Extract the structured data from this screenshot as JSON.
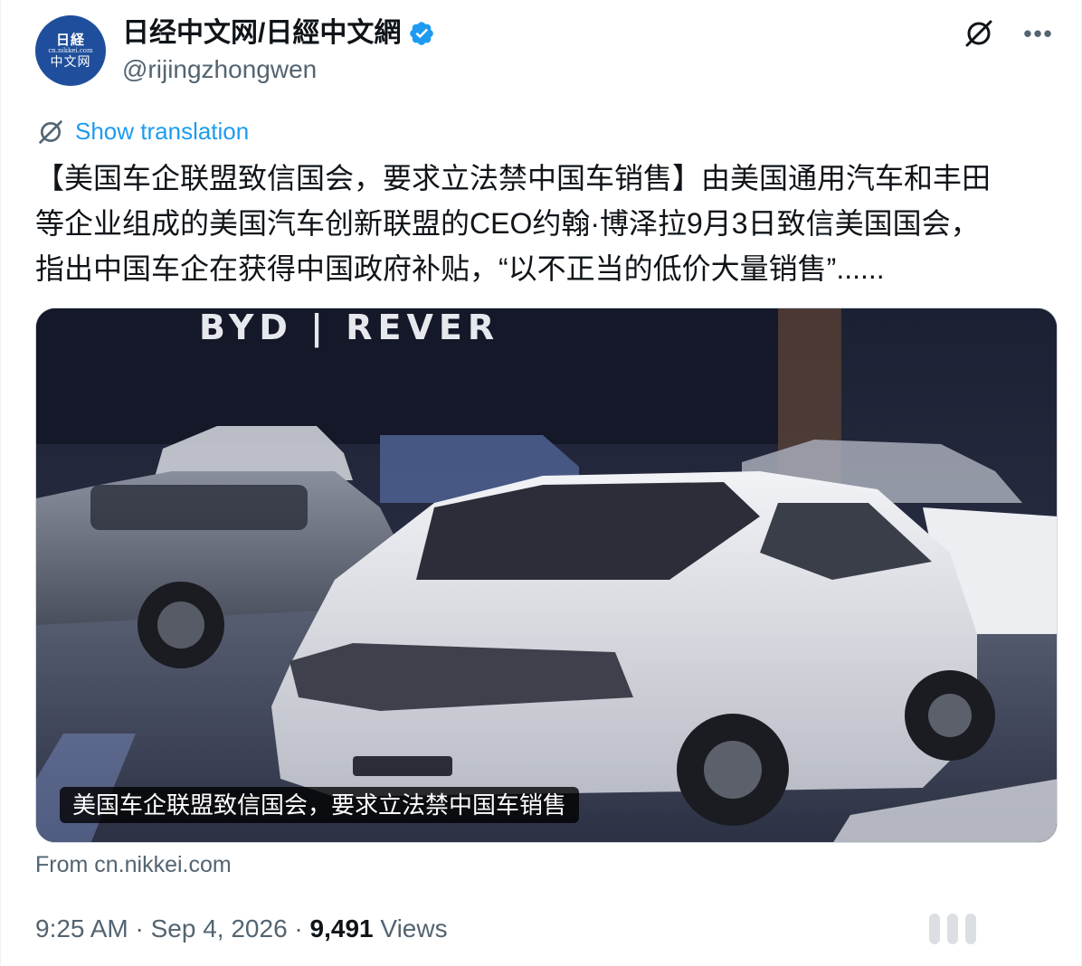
{
  "author": {
    "display_name": "日经中文网/日經中文網",
    "handle": "@rijingzhongwen",
    "avatar_text": {
      "line1": "日経",
      "line2": "cn.nikkei.com",
      "line3": "中文网"
    }
  },
  "translate": {
    "label": "Show translation"
  },
  "tweet": {
    "lines": [
      "【美国车企联盟致信国会，要求立法禁中国车销售】由美国通用汽车和丰田",
      "等企业组成的美国汽车创新联盟的CEO约翰·博泽拉9月3日致信美国国会，",
      "指出中国车企在获得中国政府补贴，“以不正当的低价大量销售”......"
    ]
  },
  "media": {
    "caption": "美国车企联盟致信国会，要求立法禁中国车销售",
    "signage": "BYD | REVER"
  },
  "card": {
    "source": "From cn.nikkei.com"
  },
  "meta": {
    "time": "9:25 AM",
    "separator": " · ",
    "date": "Sep 4, 2026",
    "views_count": "9,491",
    "views_label": " Views"
  },
  "icons": {
    "verified": "verified-badge-icon",
    "grok": "grok-icon",
    "more": "more-icon",
    "translate": "translate-icon"
  },
  "colors": {
    "link": "#1d9bf0",
    "secondary": "#536471",
    "primary": "#0f1419",
    "avatar_bg": "#1f4f9c"
  }
}
